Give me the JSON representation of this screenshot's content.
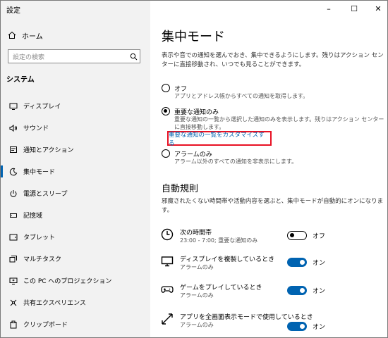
{
  "window": {
    "title": "設定",
    "minimize": "–",
    "maximize": "☐",
    "close": "✕"
  },
  "sidebar": {
    "home": "ホーム",
    "search_placeholder": "設定の検索",
    "section": "システム",
    "items": [
      {
        "label": "ディスプレイ",
        "icon": "monitor-icon"
      },
      {
        "label": "サウンド",
        "icon": "speaker-icon"
      },
      {
        "label": "通知とアクション",
        "icon": "notification-icon"
      },
      {
        "label": "集中モード",
        "icon": "moon-icon",
        "selected": true
      },
      {
        "label": "電源とスリープ",
        "icon": "power-icon"
      },
      {
        "label": "記憶域",
        "icon": "storage-icon"
      },
      {
        "label": "タブレット",
        "icon": "tablet-icon"
      },
      {
        "label": "マルチタスク",
        "icon": "multitask-icon"
      },
      {
        "label": "この PC へのプロジェクション",
        "icon": "projection-icon"
      },
      {
        "label": "共有エクスペリエンス",
        "icon": "share-icon"
      },
      {
        "label": "クリップボード",
        "icon": "clipboard-icon"
      }
    ]
  },
  "main": {
    "title": "集中モード",
    "description": "表示や音での通知を選んでおき、集中できるようにします。残りはアクション センターに直接移動され、いつでも見ることができます。",
    "options": [
      {
        "label": "オフ",
        "sub": "アプリとアドレス帳からすべての通知を取得します。",
        "selected": false
      },
      {
        "label": "重要な通知のみ",
        "sub": "重要な通知の一覧から選択した通知のみを表示します。残りはアクション センターに直接移動します。",
        "selected": true
      },
      {
        "label": "アラームのみ",
        "sub": "アラーム以外のすべての通知を非表示にします。",
        "selected": false
      }
    ],
    "link": "重要な通知の一覧をカスタマイズする",
    "auto_title": "自動規則",
    "auto_description": "邪魔されたくない時間帯や活動内容を選ぶと、集中モードが自動的にオンになります。",
    "rules": [
      {
        "name": "次の時間帯",
        "sub": "23:00 - 7:00; 重要な通知のみ",
        "state": "オフ",
        "on": false,
        "icon": "clock-icon"
      },
      {
        "name": "ディスプレイを複製しているとき",
        "sub": "アラームのみ",
        "state": "オン",
        "on": true,
        "icon": "monitor-icon"
      },
      {
        "name": "ゲームをプレイしているとき",
        "sub": "アラームのみ",
        "state": "オン",
        "on": true,
        "icon": "gamepad-icon"
      },
      {
        "name": "アプリを全画面表示モードで使用しているとき",
        "sub": "アラームのみ",
        "state": "オン",
        "on": true,
        "icon": "fullscreen-icon"
      }
    ]
  }
}
